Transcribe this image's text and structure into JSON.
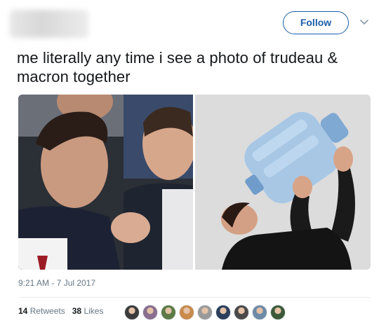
{
  "header": {
    "follow_label": "Follow"
  },
  "tweet": {
    "text": "me literally any time i see a photo of trudeau & macron together",
    "timestamp": "9:21 AM - 7 Jul 2017"
  },
  "stats": {
    "retweets_count": "14",
    "retweets_label": "Retweets",
    "likes_count": "38",
    "likes_label": "Likes"
  },
  "colors": {
    "link": "#1b5ea8",
    "muted": "#657786",
    "text": "#14171a"
  },
  "avatars": [
    {
      "color": "#3b3b3b"
    },
    {
      "color": "#8a6d8f"
    },
    {
      "color": "#5b7a46"
    },
    {
      "color": "#c98a4b"
    },
    {
      "color": "#9a9a9a"
    },
    {
      "color": "#2b3f5c"
    },
    {
      "color": "#4a4a4a"
    },
    {
      "color": "#6d8aa6"
    },
    {
      "color": "#3c5a3a"
    }
  ]
}
